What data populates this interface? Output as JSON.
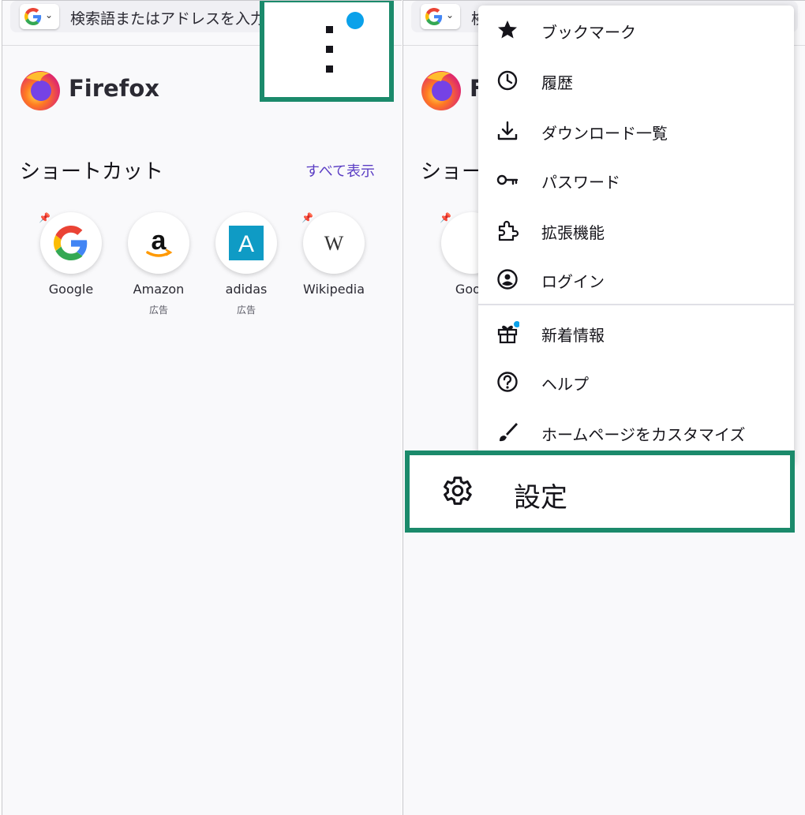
{
  "left": {
    "search_placeholder": "検索語またはアドレスを入力",
    "engine_icon": "google-icon",
    "brand": "Firefox",
    "shortcuts_title": "ショートカット",
    "show_all": "すべて表示",
    "shortcuts": [
      {
        "name": "Google",
        "ad": "",
        "pinned": true,
        "icon": "google-icon"
      },
      {
        "name": "Amazon",
        "ad": "広告",
        "pinned": false,
        "icon": "amazon-icon"
      },
      {
        "name": "adidas",
        "ad": "広告",
        "pinned": false,
        "icon": "adidas-icon"
      },
      {
        "name": "Wikipedia",
        "ad": "",
        "pinned": true,
        "icon": "wikipedia-icon"
      }
    ]
  },
  "right": {
    "search_placeholder": "検",
    "partial_shortcut_title": "ショー",
    "partial_shortcut_name": "Goog",
    "partial_brand": "F",
    "menu": [
      {
        "label": "ブックマーク",
        "icon": "star-icon"
      },
      {
        "label": "履歴",
        "icon": "clock-icon"
      },
      {
        "label": "ダウンロード一覧",
        "icon": "download-icon"
      },
      {
        "label": "パスワード",
        "icon": "key-icon"
      },
      {
        "label": "拡張機能",
        "icon": "puzzle-icon"
      },
      {
        "label": "ログイン",
        "icon": "account-icon"
      },
      {
        "label": "新着情報",
        "icon": "gift-icon"
      },
      {
        "label": "ヘルプ",
        "icon": "help-icon"
      },
      {
        "label": "ホームページをカスタマイズ",
        "icon": "brush-icon"
      }
    ],
    "settings": {
      "label": "設定",
      "icon": "gear-icon"
    }
  },
  "colors": {
    "highlight": "#1b8a6b",
    "notification": "#0aa1ea",
    "link": "#5b3ec4"
  }
}
